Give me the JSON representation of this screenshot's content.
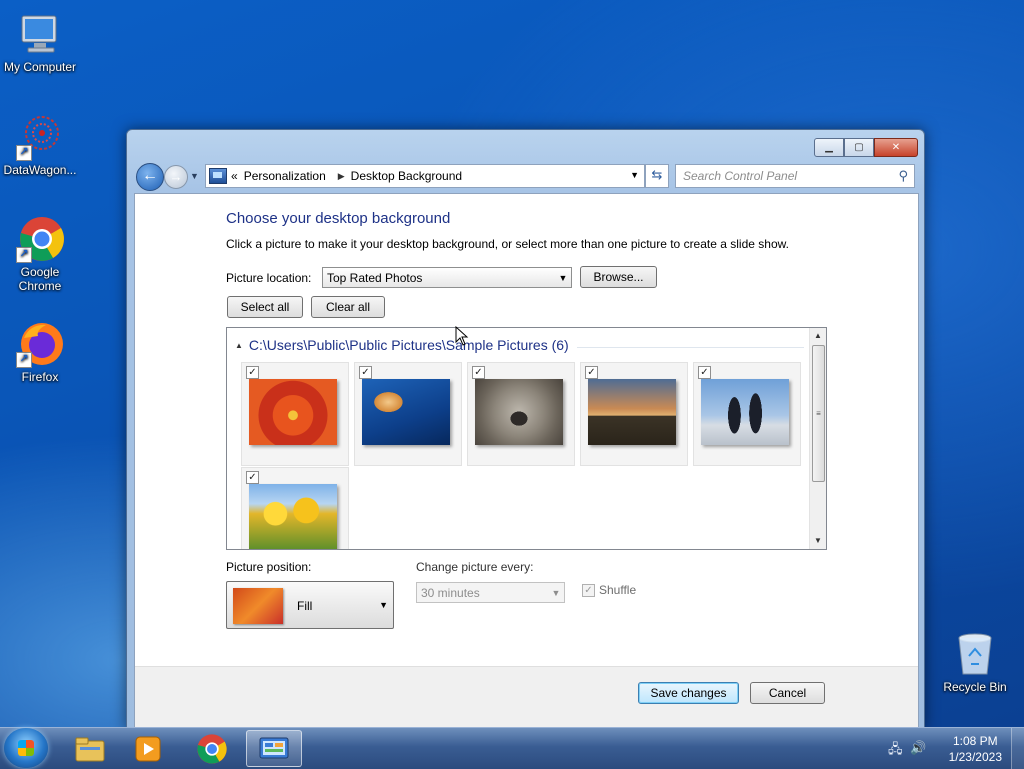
{
  "desktop": {
    "icons": [
      {
        "label": "My Computer"
      },
      {
        "label": "DataWagon..."
      },
      {
        "label": "Google Chrome"
      },
      {
        "label": "Firefox"
      },
      {
        "label": "Recycle Bin"
      }
    ]
  },
  "window": {
    "breadcrumbs": [
      "Personalization",
      "Desktop Background"
    ],
    "breadcrumb_prefix": "«",
    "search_placeholder": "Search Control Panel",
    "title": "Choose your desktop background",
    "description": "Click a picture to make it your desktop background, or select more than one picture to create a slide show.",
    "picture_location_label": "Picture location:",
    "picture_location_value": "Top Rated Photos",
    "browse_label": "Browse...",
    "select_all_label": "Select all",
    "clear_all_label": "Clear all",
    "gallery": {
      "group_header": "C:\\Users\\Public\\Public Pictures\\Sample Pictures (6)",
      "items": [
        {
          "name": "Chrysanthemum",
          "checked": true
        },
        {
          "name": "Jellyfish",
          "checked": true
        },
        {
          "name": "Koala",
          "checked": true
        },
        {
          "name": "Lighthouse",
          "checked": true
        },
        {
          "name": "Penguins",
          "checked": true
        },
        {
          "name": "Tulips",
          "checked": true
        }
      ]
    },
    "picture_position_label": "Picture position:",
    "picture_position_value": "Fill",
    "change_every_label": "Change picture every:",
    "change_every_value": "30 minutes",
    "shuffle_label": "Shuffle",
    "save_label": "Save changes",
    "cancel_label": "Cancel"
  },
  "taskbar": {
    "time": "1:08 PM",
    "date": "1/23/2023"
  }
}
